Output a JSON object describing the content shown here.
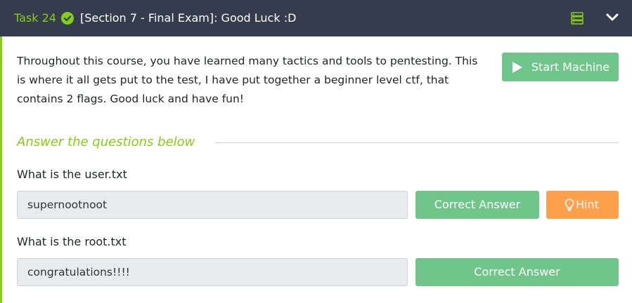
{
  "header": {
    "task_label": "Task 24",
    "title": "[Section 7 - Final Exam]: Good Luck :D",
    "icons": [
      "check-circle-icon",
      "server-icon",
      "chevron-down-icon"
    ]
  },
  "description": "Throughout this course, you have learned many tactics and tools to pentesting. This is where it all gets put to the test, I have put together a beginner level ctf, that contains 2 flags. Good luck and have fun!",
  "start_machine": {
    "label": "Start Machine",
    "icon": "play-icon"
  },
  "answer_heading": "Answer the questions below",
  "questions": [
    {
      "question": "What is the user.txt",
      "answer": "supernootnoot",
      "submit_label": "Correct Answer",
      "hint_label": "Hint",
      "hint_icon": "lightbulb-icon"
    },
    {
      "question": "What is the root.txt",
      "answer": "congratulations!!!!",
      "submit_label": "Correct Answer"
    }
  ],
  "colors": {
    "header_bg": "#343c4e",
    "accent_green": "#88cc14",
    "button_green": "#6fc58a",
    "hint_orange": "#ffa04d",
    "field_bg": "#e9ecef"
  }
}
